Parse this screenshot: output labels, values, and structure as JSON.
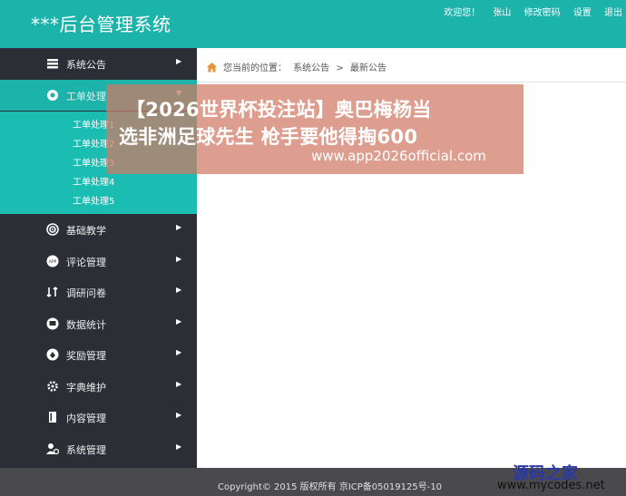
{
  "header": {
    "title": "***后台管理系统",
    "links": [
      "欢迎您！",
      "张山",
      "修改密码",
      "设置",
      "退出"
    ]
  },
  "sidebar": {
    "items": [
      {
        "label": "系统公告",
        "icon": "stack-icon"
      },
      {
        "label": "工单处理",
        "icon": "gear-icon"
      },
      {
        "label": "基础教学",
        "icon": "target-icon"
      },
      {
        "label": "评论管理",
        "icon": "app-icon"
      },
      {
        "label": "调研问卷",
        "icon": "flow-icon"
      },
      {
        "label": "数据统计",
        "icon": "monitor-icon"
      },
      {
        "label": "奖励管理",
        "icon": "medal-icon"
      },
      {
        "label": "字典维护",
        "icon": "cog-icon"
      },
      {
        "label": "内容管理",
        "icon": "book-icon"
      },
      {
        "label": "系统管理",
        "icon": "user-gear-icon"
      }
    ],
    "submenu": [
      "工单处理1",
      "工单处理2",
      "工单处理3",
      "工单处理4",
      "工单处理5"
    ]
  },
  "breadcrumb": {
    "prefix": "您当前的位置：",
    "items": [
      "系统公告",
      ">",
      "最新公告"
    ]
  },
  "footer": {
    "copyright": "Copyright© 2015 版权所有 京ICP备05019125号-10"
  },
  "ad": {
    "line1": "【2026世界杯投注站】奥巴梅杨当",
    "line2": "选非洲足球先生 枪手要他得掏600",
    "url": "www.app2026official.com"
  },
  "watermark": {
    "brand": "源码之家",
    "site": "www.mycodes.net"
  },
  "colors": {
    "accent": "#1bb3aa",
    "sidebar": "#2b2e35",
    "footer": "#4a4a4d"
  }
}
